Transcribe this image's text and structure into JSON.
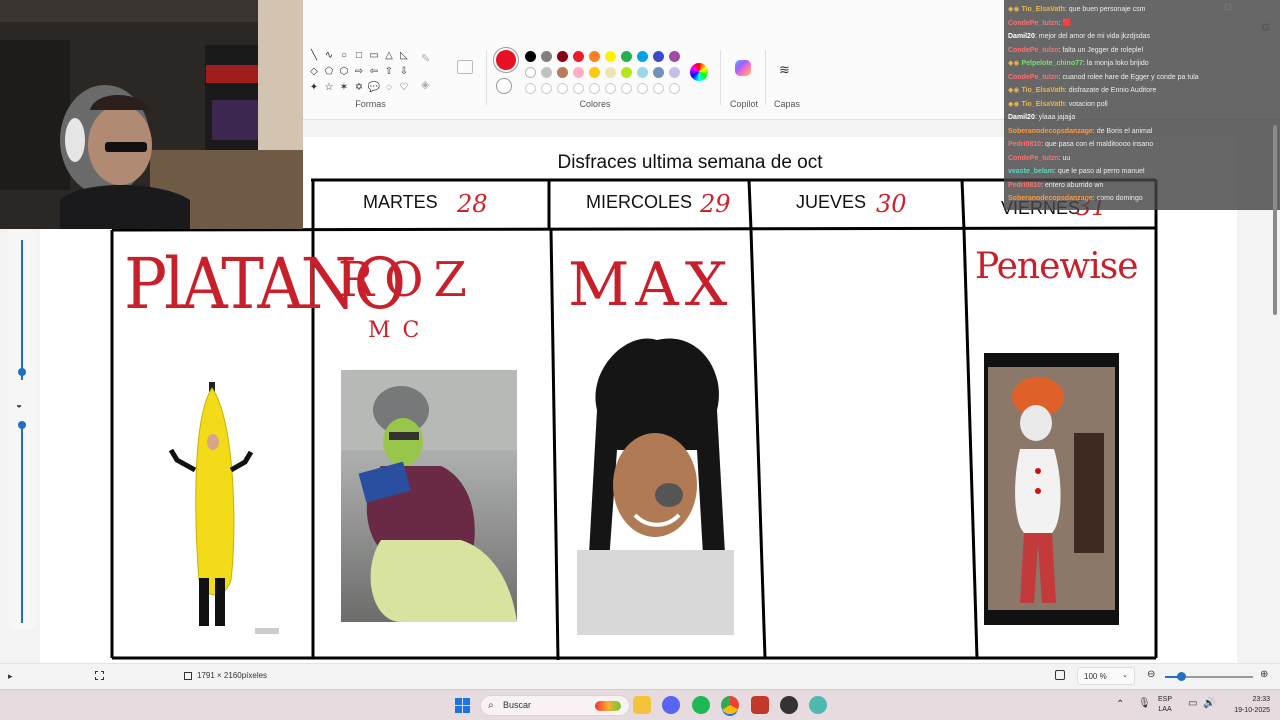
{
  "ribbon": {
    "shapes_label": "Formas",
    "colors_label": "Colores",
    "copilot_label": "Copilot",
    "layers_label": "Capas",
    "shape_glyphs": [
      "╲",
      "∿",
      "○",
      "□",
      "▭",
      "△",
      "◺",
      "◇",
      "⬠",
      "⬡",
      "⇨",
      "⇦",
      "⇧",
      "⇩",
      "✦",
      "☆",
      "✶",
      "✡",
      "💬",
      "◌",
      "♡"
    ],
    "palette_row1": [
      "#000000",
      "#7f7f7f",
      "#880015",
      "#ed1c24",
      "#ff7f27",
      "#fff200",
      "#22b14c",
      "#00a2e8",
      "#3f48cc",
      "#a349a4"
    ],
    "palette_row2": [
      "#ffffff",
      "#c3c3c3",
      "#b97a57",
      "#ffaec9",
      "#ffc90e",
      "#efe4b0",
      "#b5e61d",
      "#99d9ea",
      "#7092be",
      "#c8bfe7"
    ],
    "selected_color": "#e81123"
  },
  "document": {
    "title": "Disfraces ultima semana de oct",
    "days": [
      {
        "name": "MARTES",
        "num": "28"
      },
      {
        "name": "MIERCOLES",
        "num": "29"
      },
      {
        "name": "JUEVES",
        "num": "30"
      },
      {
        "name": "VIERNES",
        "num": "31"
      }
    ],
    "costumes": {
      "col0": "PlATANO",
      "col1": "ROZ",
      "col1_sub": "MC",
      "col2": "MAX",
      "col3": "",
      "col4": "Penewise"
    }
  },
  "chat": {
    "messages": [
      {
        "user": "Tio_ElsaVath",
        "text": "que buen personaje csm",
        "color": "#e8b64a",
        "badge": true
      },
      {
        "user": "CondePe_tulzn",
        "text": "🟥",
        "color": "#ff6f6f",
        "badge": false
      },
      {
        "user": "Damil20",
        "text": "mejor del amor de mi vida jkzdjsdas",
        "color": "#ffffff",
        "badge": false
      },
      {
        "user": "CondePe_tulzn",
        "text": "falta un Jegger de roleplel",
        "color": "#ff6f6f",
        "badge": false
      },
      {
        "user": "Pelpelote_chino77",
        "text": "la monja loko brijido",
        "color": "#7adf7a",
        "badge": true
      },
      {
        "user": "CondePe_tulzn",
        "text": "cuanod rolee hare de Egger y conde pa tula",
        "color": "#ff6f6f",
        "badge": false
      },
      {
        "user": "Tio_ElsaVath",
        "text": "disfrazate de Ennio Auditore",
        "color": "#e8b64a",
        "badge": true
      },
      {
        "user": "Tio_ElsaVath",
        "text": "votacion poll",
        "color": "#e8b64a",
        "badge": true
      },
      {
        "user": "Damil20",
        "text": "ylaaa jajajja",
        "color": "#ffffff",
        "badge": false
      },
      {
        "user": "Soberanodecopsdanzage",
        "text": "de Boris el animal",
        "color": "#ff9a3c",
        "badge": false
      },
      {
        "user": "Pedri0810",
        "text": "que pasa con el malditoooo insano",
        "color": "#ff6f6f",
        "badge": false
      },
      {
        "user": "CondePe_tulzn",
        "text": "uu",
        "color": "#ff6f6f",
        "badge": false
      },
      {
        "user": "veaste_belam",
        "text": "que le paso al perro manuel",
        "color": "#5fd3c8",
        "badge": false
      },
      {
        "user": "Pedri0810",
        "text": "entero aburrido wn",
        "color": "#ff6f6f",
        "badge": false
      },
      {
        "user": "Soberanodecopsdanzage",
        "text": "como domingo",
        "color": "#ff9a3c",
        "badge": false
      }
    ]
  },
  "statusbar": {
    "dimensions": "1791 × 2160píxeles",
    "zoom": "100 %"
  },
  "taskbar": {
    "search_placeholder": "Buscar",
    "language": "ESP",
    "language_sub": "LAA",
    "time": "23:33",
    "date": "19-10-2025"
  }
}
